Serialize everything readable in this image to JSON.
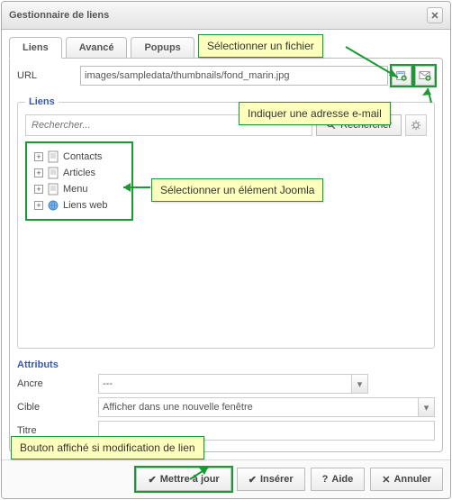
{
  "dialog": {
    "title": "Gestionnaire de liens"
  },
  "tabs": {
    "links": "Liens",
    "advanced": "Avancé",
    "popups": "Popups"
  },
  "url": {
    "label": "URL",
    "value": "images/sampledata/thumbnails/fond_marin.jpg"
  },
  "links_panel": {
    "legend": "Liens",
    "search_placeholder": "Rechercher...",
    "search_button": "Rechercher"
  },
  "tree": {
    "items": [
      {
        "label": "Contacts",
        "icon": "page"
      },
      {
        "label": "Articles",
        "icon": "page"
      },
      {
        "label": "Menu",
        "icon": "page"
      },
      {
        "label": "Liens web",
        "icon": "globe"
      }
    ]
  },
  "attributes": {
    "legend": "Attributs",
    "anchor_label": "Ancre",
    "anchor_value": "---",
    "target_label": "Cible",
    "target_value": "Afficher dans une nouvelle fenêtre",
    "title_label": "Titre",
    "title_value": ""
  },
  "footer": {
    "update": "Mettre à jour",
    "insert": "Insérer",
    "help": "Aide",
    "cancel": "Annuler"
  },
  "callouts": {
    "select_file": "Sélectionner un fichier",
    "email": "Indiquer une adresse e-mail",
    "joomla": "Sélectionner un élément Joomla",
    "update_btn": "Bouton affiché si modification de lien"
  }
}
